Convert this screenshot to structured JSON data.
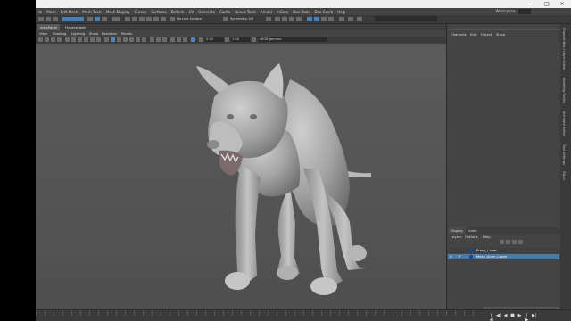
{
  "menubar": {
    "items": [
      "ile",
      "Mesh",
      "Edit Mesh",
      "Mesh Tools",
      "Mesh Display",
      "Curves",
      "Surfaces",
      "Deform",
      "UV",
      "Generate",
      "Cache",
      "Bonus Tools",
      "Arnold",
      "mGear",
      "Doe Tools",
      "Doe Exorb",
      "Help"
    ],
    "workspace_label": "Workspace :"
  },
  "statusline": {
    "no_live_surface": "No Live Surface",
    "symmetry": "Symmetry: Off"
  },
  "panel": {
    "tabs": [
      "viewPanel",
      "Hypershade"
    ]
  },
  "viewport_menu": [
    "View",
    "Shading",
    "Lighting",
    "Show",
    "Renderer",
    "Panels"
  ],
  "viewport_toolbar": {
    "field1": "0.00",
    "field2": "1.00",
    "color_space": "sRGB gamma"
  },
  "right_panel": {
    "tabs": [
      "Channels",
      "Edit",
      "Object",
      "Show"
    ]
  },
  "layers": {
    "tabs": [
      "Display",
      "Anim"
    ],
    "menu": [
      "Layers",
      "Options",
      "Help"
    ],
    "rows": [
      {
        "label": "Proxy_Layer",
        "selected": false
      },
      {
        "label": "Mesh_Anim_Layer",
        "selected": true
      }
    ]
  },
  "side_strip": [
    "Channel Box / Layer Editor",
    "Modeling Toolkit",
    "Attribute Editor",
    "Tool Settings",
    "XGen"
  ],
  "colors": {
    "accent": "#4a7fb4",
    "viewport_bg": "#555555",
    "selected_row": "#4d7ba6"
  }
}
